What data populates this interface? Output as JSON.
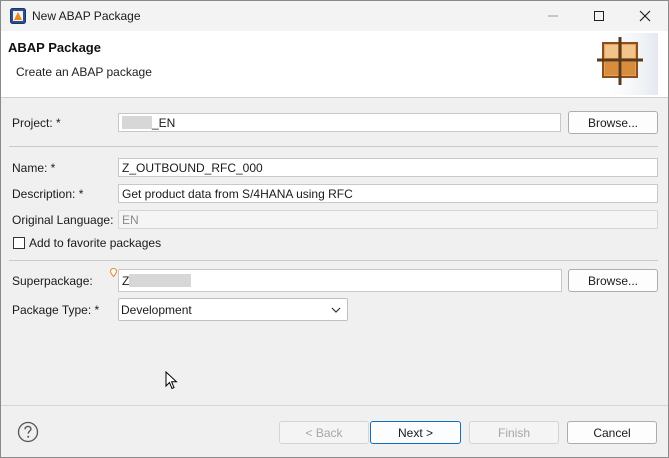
{
  "window": {
    "title": "New ABAP Package"
  },
  "header": {
    "title": "ABAP Package",
    "subtitle": "Create an ABAP package"
  },
  "form": {
    "project": {
      "label": "Project: *",
      "value_suffix": "_EN",
      "browse_label": "Browse..."
    },
    "name": {
      "label": "Name: *",
      "value": "Z_OUTBOUND_RFC_000"
    },
    "description": {
      "label": "Description: *",
      "value": "Get product data from S/4HANA using RFC"
    },
    "original_language": {
      "label": "Original Language:",
      "value": "EN"
    },
    "favorite": {
      "label": "Add to favorite packages",
      "checked": false
    },
    "superpackage": {
      "label": "Superpackage:",
      "value_prefix": "Z",
      "browse_label": "Browse..."
    },
    "package_type": {
      "label": "Package Type: *",
      "selected": "Development"
    }
  },
  "footer": {
    "back_label": "< Back",
    "next_label": "Next >",
    "finish_label": "Finish",
    "cancel_label": "Cancel"
  },
  "icons": {
    "app": "eclipse-abap-icon",
    "help": "help-icon",
    "header_art": "package-icon"
  },
  "colors": {
    "primary_border": "#0b6fbf",
    "header_bg": "#ffffff",
    "body_bg": "#f0f0f0"
  }
}
